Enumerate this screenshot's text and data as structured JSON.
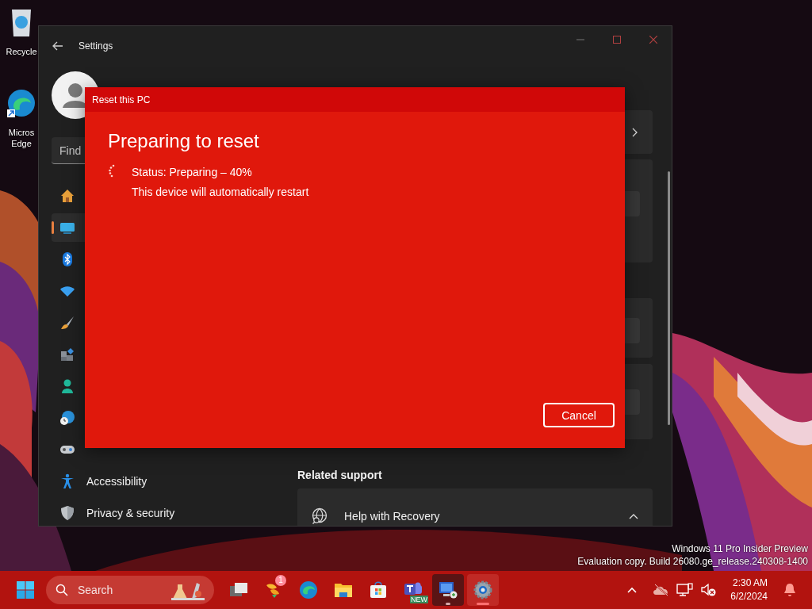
{
  "desktop": {
    "icons": [
      {
        "kind": "recycle-bin",
        "lines": [
          "Recycle"
        ]
      },
      {
        "kind": "browser",
        "lines": [
          "Micros",
          "Edge"
        ]
      }
    ],
    "build_info": [
      "Windows 11 Pro Insider Preview",
      "Evaluation copy. Build 26080.ge_release.240308-1400"
    ]
  },
  "settings": {
    "title": "Settings",
    "search": {
      "placeholder": "Find"
    },
    "nav": [
      {
        "kind": "home",
        "selected": false
      },
      {
        "kind": "system",
        "selected": true
      },
      {
        "kind": "bluetooth",
        "selected": false
      },
      {
        "kind": "network",
        "selected": false
      },
      {
        "kind": "personalization",
        "selected": false
      },
      {
        "kind": "apps",
        "selected": false
      },
      {
        "kind": "accounts",
        "selected": false
      },
      {
        "kind": "time",
        "selected": false
      },
      {
        "kind": "gaming",
        "selected": false
      },
      {
        "kind": "accessibility",
        "label": "Accessibility",
        "selected": false
      },
      {
        "kind": "privacy",
        "label": "Privacy & security",
        "selected": false
      }
    ],
    "related_support": {
      "heading": "Related support",
      "items": [
        {
          "label": "Help with Recovery",
          "expanded": true
        }
      ]
    }
  },
  "dialog": {
    "title": "Reset this PC",
    "heading": "Preparing to reset",
    "status": "Status: Preparing – 40%",
    "note": "This device will automatically restart",
    "buttons": [
      "Cancel"
    ]
  },
  "taskbar": {
    "search": {
      "placeholder": "Search"
    },
    "apps": [
      {
        "kind": "task-view",
        "hovered": false,
        "running": false,
        "active": false
      },
      {
        "kind": "widgets",
        "badge": "1",
        "hovered": false,
        "running": false,
        "active": false
      },
      {
        "kind": "edge",
        "hovered": false,
        "running": false,
        "active": false
      },
      {
        "kind": "explorer",
        "hovered": false,
        "running": false,
        "active": false
      },
      {
        "kind": "store",
        "hovered": false,
        "running": false,
        "active": false
      },
      {
        "kind": "teams",
        "tag": "NEW",
        "hovered": false,
        "running": false,
        "active": false
      },
      {
        "kind": "remote",
        "hovered": true,
        "running": true,
        "active": false
      },
      {
        "kind": "settings",
        "hovered": false,
        "running": true,
        "active": true
      }
    ],
    "tray": {
      "time": "2:30 AM",
      "date": "6/2/2024"
    }
  }
}
